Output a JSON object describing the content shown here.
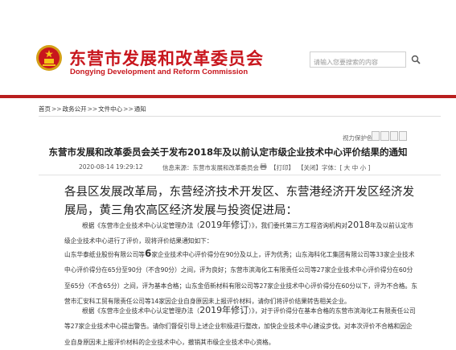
{
  "header": {
    "title_cn": "东营市发展和改革委员会",
    "title_en": "Dongying Development and Reform Commission",
    "search_placeholder": "请输入您要搜索的内容",
    "emblem_icon": "national-emblem-icon",
    "search_icon": "search-icon",
    "brand_color": "#c8161d"
  },
  "breadcrumb": {
    "home": "首页",
    "sep": ">>",
    "open": "政务公开",
    "center": "文件中心",
    "notice": "通知"
  },
  "article": {
    "view_count_label": "视力保护色",
    "title": "东营市发展和改革委员会关于发布2018年及以前认定市级企业技术中心评价结果的通知",
    "datetime": "2020-08-14 19:29:12",
    "source": "信息来源：东营市发展和改革委员会",
    "print": "【打印】",
    "close": "【关闭】",
    "font_size": "字体：[ 大 中 小 ]",
    "salutation": "各县区发展改革局，东营经济技术开发区、东营港经济开发区经济发展局，黄三角农高区经济发展与投资促进局：",
    "p1": {
      "a": "根据《东营市企业技术中心认定管理办法（",
      "b": "2019年修订",
      "c": "）》，我们委托第三方工程咨询机构对",
      "d": "2018",
      "e": "年及以前认定市级企业技术中心进行了评价，现将评价结果通知如下："
    },
    "p2": {
      "a": "山东华泰纸业股份有限公司等",
      "b": "6",
      "c": "家企业技术中心评价得分在90分及以上，评为优秀；山东海科化工集团有限公司等33家企业技术中心评价得分在65分至90分（不含90分）之间，评为良好；东营市滨海化工有限责任公司等27家企业技术中心评价得分在60分至65分（不含65分）之间，评为基本合格；山东金佰新材料有限公司等27家企业技术中心评价得分在60分以下，评为不合格。东营市汇安科工贸有限责任公司等14家因企业自身原因未上报评价材料，请你们将评价结果转告相关企业。"
    },
    "p3": {
      "a": "根据《东营市企业技术中心认定管理办法（",
      "b": "2019年修订",
      "c": "）》，对于评价得分在基本合格的东营市滨海化工有限责任公司等27家企业技术中心提出警告。请你们督促引导上述企业积极进行整改，加快企业技术中心建设步伐。对本次评价不合格和因企业自身原因未上报评价材料的企业技术中心，撤销其市级企业技术中心资格。"
    }
  }
}
